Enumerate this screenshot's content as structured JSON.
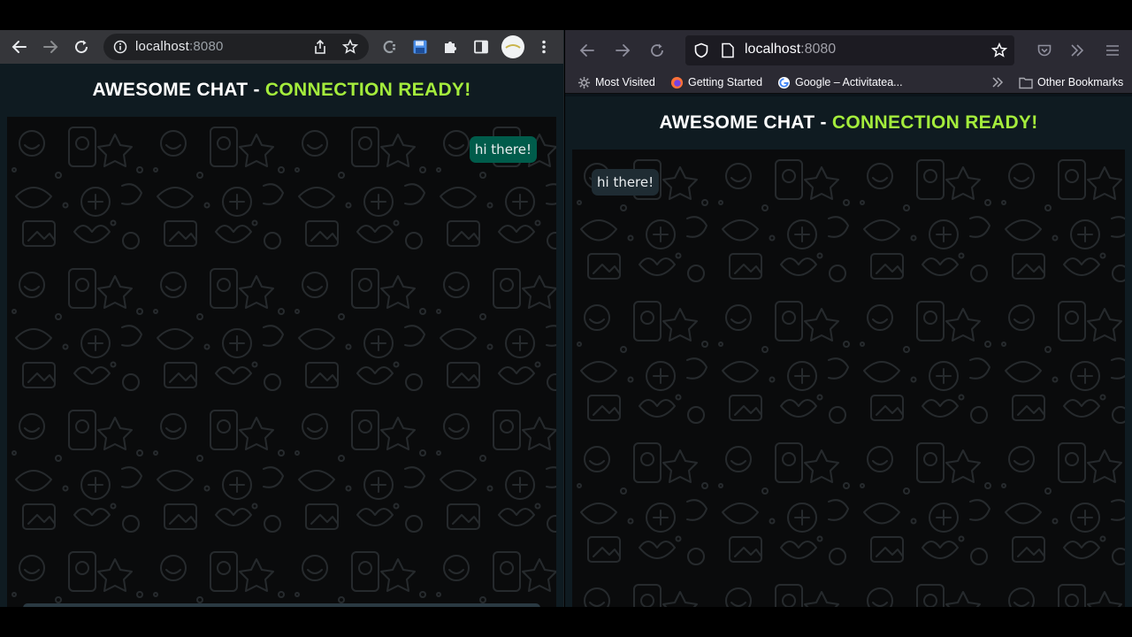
{
  "chrome": {
    "url_host": "localhost",
    "url_port": ":8080",
    "icons": [
      "back-arrow-icon",
      "forward-arrow-icon",
      "reload-icon",
      "info-icon",
      "share-icon",
      "star-icon",
      "extension-icon",
      "save-icon",
      "puzzle-icon",
      "sidepanel-icon",
      "profile-avatar",
      "kebab-menu-icon"
    ]
  },
  "firefox": {
    "url_host": "localhost",
    "url_port": ":8080",
    "bookmarks": [
      {
        "label": "Most Visited",
        "icon": "gear-icon"
      },
      {
        "label": "Getting Started",
        "icon": "firefox-logo-icon"
      },
      {
        "label": "Google – Activitatea...",
        "icon": "google-logo-icon"
      }
    ],
    "other_bookmarks": "Other Bookmarks"
  },
  "app": {
    "title_prefix": "AWESOME CHAT - ",
    "title_status": "CONNECTION READY!"
  },
  "messages": {
    "left_outgoing": "hi there!",
    "right_incoming": "hi there!"
  },
  "colors": {
    "header_bg": "#0f1b21",
    "status_green": "#a4ec3c",
    "outgoing_bubble": "#005c4b",
    "incoming_bubble": "#1f2c33",
    "chat_bg": "#0a0b0c"
  }
}
